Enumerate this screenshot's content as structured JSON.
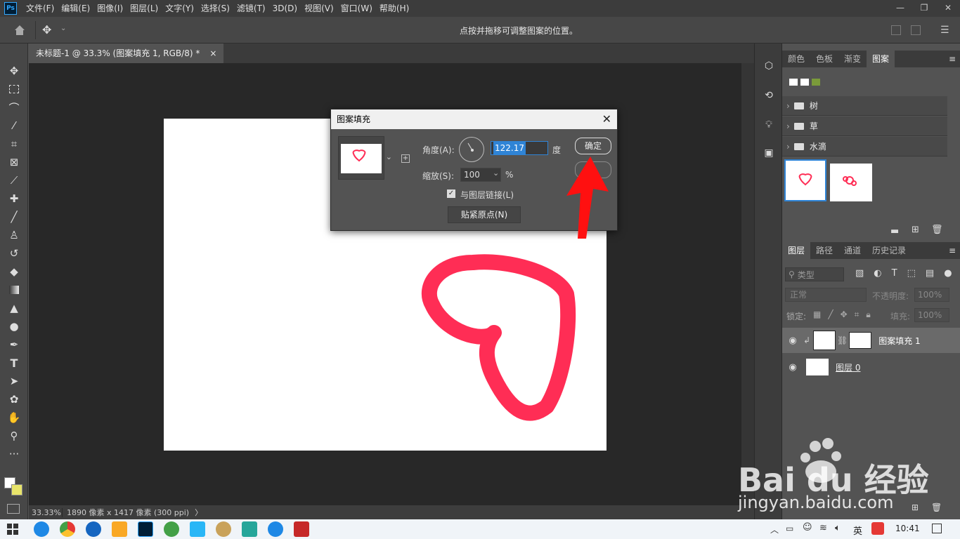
{
  "app": {
    "logo": "Ps"
  },
  "menu": [
    "文件(F)",
    "编辑(E)",
    "图像(I)",
    "图层(L)",
    "文字(Y)",
    "选择(S)",
    "滤镜(T)",
    "3D(D)",
    "视图(V)",
    "窗口(W)",
    "帮助(H)"
  ],
  "window_controls": {
    "minimize": "—",
    "restore": "❐",
    "close": "✕"
  },
  "options_bar": {
    "hint": "点按并拖移可调整图案的位置。"
  },
  "document_tab": {
    "title": "未标题-1 @ 33.3% (图案填充 1, RGB/8) *",
    "close": "×"
  },
  "status_bar": {
    "zoom": "33.33%",
    "size": "1890 像素 x 1417 像素 (300 ppi)",
    "arrow": "〉"
  },
  "dialog": {
    "title": "图案填充",
    "close": "✕",
    "angle_label": "角度(A):",
    "angle_value": "122.17",
    "angle_unit": "度",
    "scale_label": "缩放(S):",
    "scale_value": "100",
    "scale_unit": "%",
    "link_label": "与图层链接(L)",
    "snap_button": "贴紧原点(N)",
    "ok_button": "确定"
  },
  "swatches_panel": {
    "tabs": [
      "颜色",
      "色板",
      "渐变",
      "图案"
    ],
    "folders": [
      "树",
      "草",
      "水滴"
    ]
  },
  "layers_panel": {
    "tabs": [
      "图层",
      "路径",
      "通道",
      "历史记录"
    ],
    "filter_label": "类型",
    "blend_mode": "正常",
    "opacity_label": "不透明度:",
    "opacity_value": "100%",
    "lock_label": "锁定:",
    "fill_label": "填充:",
    "fill_value": "100%",
    "layers": [
      {
        "name": "图案填充 1"
      },
      {
        "name": "图层 0"
      }
    ]
  },
  "taskbar": {
    "time": "10:41",
    "ime": "英"
  },
  "watermark": {
    "brand": "Bai du 经验",
    "url": "jingyan.baidu.com"
  },
  "colors": {
    "heart": "#ff2d55",
    "arrow": "#ff1010",
    "highlight": "#2f84d6"
  }
}
